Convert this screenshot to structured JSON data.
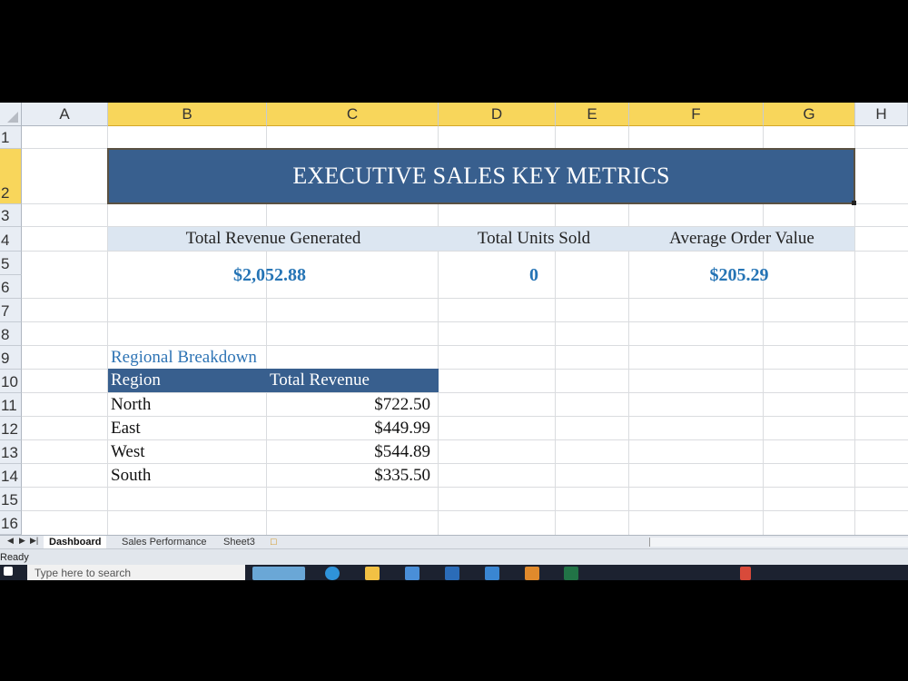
{
  "columns": [
    "A",
    "B",
    "C",
    "D",
    "E",
    "F",
    "G",
    "H"
  ],
  "rows": [
    "1",
    "2",
    "3",
    "4",
    "5",
    "6",
    "7",
    "8",
    "9",
    "10",
    "11",
    "12",
    "13",
    "14",
    "15",
    "16"
  ],
  "title": "EXECUTIVE SALES KEY METRICS",
  "metrics": [
    {
      "label": "Total Revenue Generated",
      "value": "$2,052.88"
    },
    {
      "label": "Total Units Sold",
      "value": "0"
    },
    {
      "label": "Average Order Value",
      "value": "$205.29"
    }
  ],
  "regional": {
    "title": "Regional Breakdown",
    "headers": [
      "Region",
      "Total Revenue"
    ],
    "rows": [
      {
        "region": "North",
        "revenue": "$722.50"
      },
      {
        "region": "East",
        "revenue": "$449.99"
      },
      {
        "region": "West",
        "revenue": "$544.89"
      },
      {
        "region": "South",
        "revenue": "$335.50"
      }
    ]
  },
  "sheet_tabs": [
    "Dashboard",
    "Sales Performance",
    "Sheet3"
  ],
  "active_tab": "Dashboard",
  "status": "Ready",
  "taskbar": {
    "search_placeholder": "Type here to search"
  },
  "colors": {
    "banner": "#385f8e",
    "metric_band": "#dce6f1",
    "value_text": "#2574b5",
    "selected_header": "#f8d65b"
  }
}
